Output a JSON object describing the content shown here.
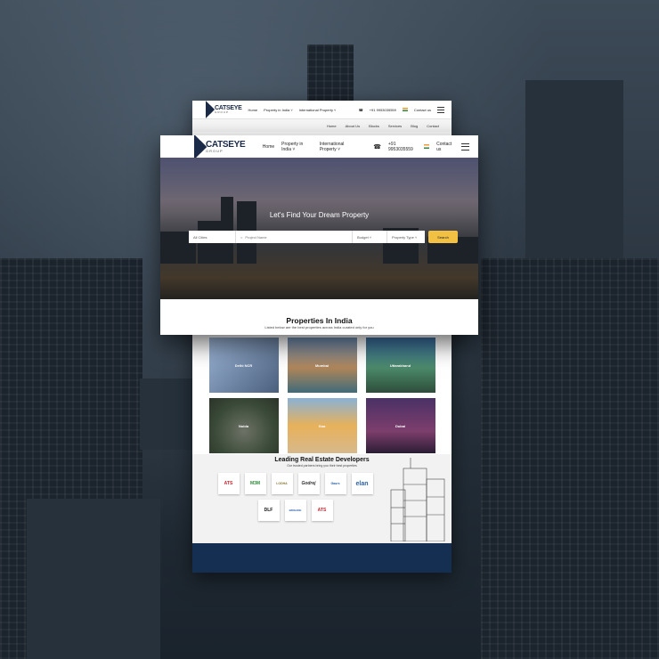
{
  "brand": {
    "name": "CATSEYE",
    "sub": "GROUP",
    "color_navy": "#1b2a47"
  },
  "nav": {
    "home": "Home",
    "property_india": "Property in India ˅",
    "property_intl": "International Property ˅",
    "phone": "+91 9953035559",
    "contact": "Contact us"
  },
  "back_page": {
    "nav": {
      "home": "Home",
      "property_india": "Property in India ˅",
      "property_intl": "International Property ˅",
      "phone": "+91 9953035559",
      "contact": "Contact us"
    },
    "subnav": [
      "Home",
      "About Us",
      "Blocks",
      "Services",
      "Blog",
      "Contact"
    ],
    "cities": [
      {
        "label": "Delhi NCR"
      },
      {
        "label": "Mumbai"
      },
      {
        "label": "Uttarakhand"
      },
      {
        "label": "Noida"
      },
      {
        "label": "Goa"
      },
      {
        "label": "Dubai"
      }
    ],
    "developers": {
      "title": "Leading Real Estate Developers",
      "subtitle": "Our trusted partners bring you their best properties",
      "row1": [
        "ATS",
        "M3M",
        "LODHA",
        "Godrej",
        "Gaurs",
        "elan"
      ],
      "row2": [
        "DLF",
        "BRIGADE",
        "ATS"
      ]
    },
    "footer_color": "#142f52"
  },
  "hero": {
    "title": "Let's Find Your Dream Property",
    "city_select": "All Cities",
    "search_placeholder": "Project Name",
    "budget": "Budget ˅",
    "property_type": "Property Type ˅",
    "search_button": "Search"
  },
  "properties": {
    "title": "Properties In India",
    "subtitle": "Listed below are the best properties across India curated only for you"
  },
  "accent": "#f2c144"
}
